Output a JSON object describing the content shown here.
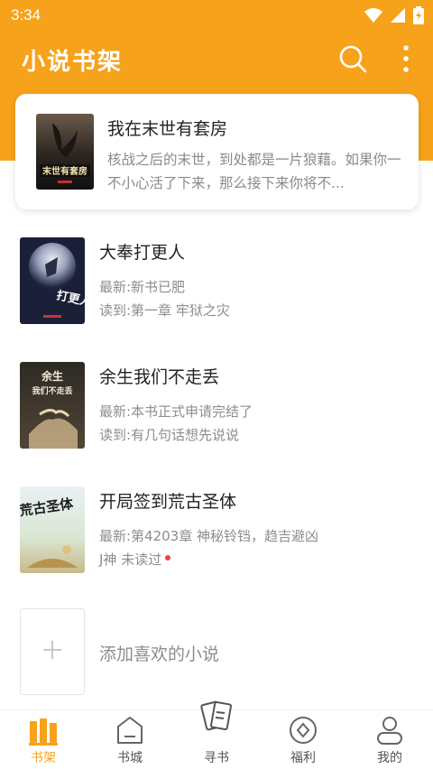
{
  "status_bar": {
    "time": "3:34"
  },
  "app_bar": {
    "title": "小说书架"
  },
  "featured": {
    "title": "我在末世有套房",
    "description": "核战之后的末世，到处都是一片狼藉。如果你一不小心活了下来，那么接下来你将不...",
    "cover_text": "末世有套房"
  },
  "books": [
    {
      "title": "大奉打更人",
      "latest": "最新:新书已肥",
      "read": "读到:第一章 牢狱之灾",
      "cover_text": "打更人",
      "unread_dot": false
    },
    {
      "title": "余生我们不走丢",
      "latest": "最新:本书正式申请完结了",
      "read": "读到:有几句话想先说说",
      "cover_text_1": "余生",
      "cover_text_2": "我们不走丢",
      "unread_dot": false
    },
    {
      "title": "开局签到荒古圣体",
      "latest": "最新:第4203章 神秘铃铛，趋吉避凶",
      "read": "J神  未读过",
      "cover_text": "荒古圣体",
      "unread_dot": true
    }
  ],
  "add_book": {
    "label": "添加喜欢的小说",
    "plus": "+"
  },
  "bottom_nav": [
    {
      "label": "书架",
      "icon": "bookshelf-icon",
      "active": true
    },
    {
      "label": "书城",
      "icon": "bookstore-icon",
      "active": false
    },
    {
      "label": "寻书",
      "icon": "find-book-icon",
      "active": false
    },
    {
      "label": "福利",
      "icon": "welfare-icon",
      "active": false
    },
    {
      "label": "我的",
      "icon": "profile-icon",
      "active": false
    }
  ],
  "colors": {
    "accent": "#f7a21b",
    "unread_dot": "#f04141"
  }
}
